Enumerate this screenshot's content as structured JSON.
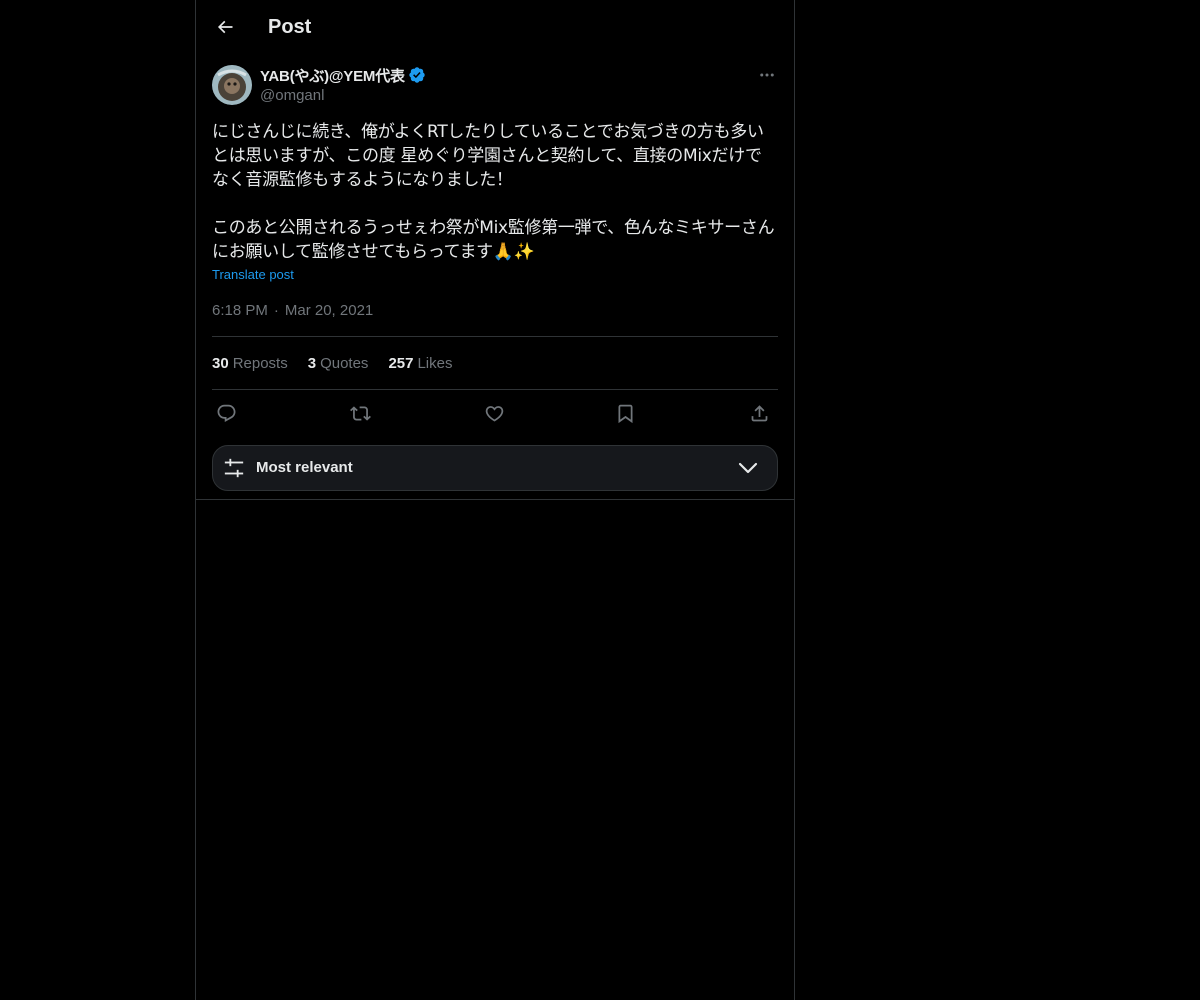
{
  "header": {
    "title": "Post"
  },
  "author": {
    "display_name": "YAB(やぶ)@YEM代表",
    "handle": "@omganl",
    "verified": true,
    "verified_color": "#1d9bf0"
  },
  "post": {
    "text": "にじさんじに続き、俺がよくRTしたりしていることでお気づきの方も多いとは思いますが、この度 星めぐり学園さんと契約して、直接のMixだけでなく音源監修もするようになりました！\n\nこのあと公開されるうっせぇわ祭がMix監修第一弾で、色んなミキサーさんにお願いして監修させてもらってます🙏✨",
    "translate_label": "Translate post",
    "time": "6:18 PM",
    "separator": "·",
    "date": "Mar 20, 2021"
  },
  "stats": {
    "reposts_count": "30",
    "reposts_label": "Reposts",
    "quotes_count": "3",
    "quotes_label": "Quotes",
    "likes_count": "257",
    "likes_label": "Likes"
  },
  "actions": [
    "reply-icon",
    "repost-icon",
    "like-icon",
    "bookmark-icon",
    "share-icon"
  ],
  "sort": {
    "label": "Most relevant"
  },
  "colors": {
    "background": "#000000",
    "text": "#e7e9ea",
    "secondary": "#71767b",
    "accent": "#1d9bf0",
    "border": "#2f3336"
  }
}
